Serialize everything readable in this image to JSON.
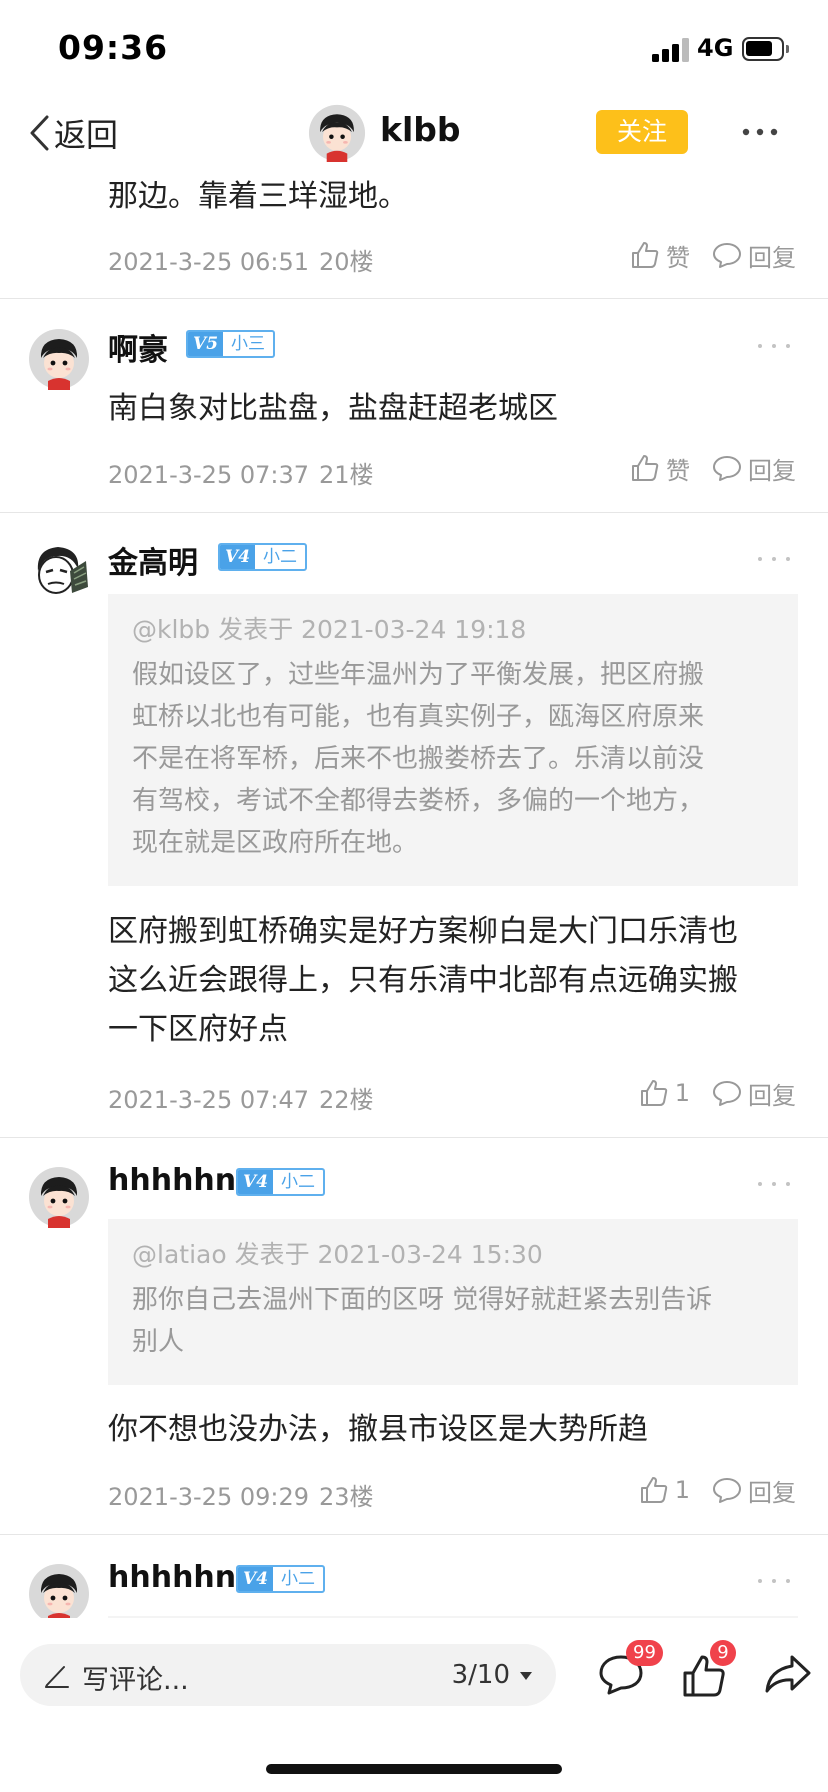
{
  "status_bar": {
    "time": "09:36",
    "network": "4G"
  },
  "nav": {
    "back_label": "返回",
    "username": "klbb",
    "follow_label": "关注"
  },
  "comments": [
    {
      "text": "那边。靠着三垟湿地。",
      "time": "2021-3-25 06:51",
      "floor": "20楼",
      "like_label": "赞",
      "reply_label": "回复"
    },
    {
      "name": "啊豪",
      "level": "V5",
      "rank": "小三",
      "text": "南白象对比盐盘，盐盘赶超老城区",
      "time": "2021-3-25 07:37",
      "floor": "21楼",
      "like_label": "赞",
      "reply_label": "回复"
    },
    {
      "name": "金高明",
      "level": "V4",
      "rank": "小二",
      "quote_meta": "@klbb 发表于 2021-03-24 19:18",
      "quote_lines": [
        "假如设区了，过些年温州为了平衡发展，把区府搬",
        "虹桥以北也有可能，也有真实例子，瓯海区府原来",
        "不是在将军桥，后来不也搬娄桥去了。乐清以前没",
        "有驾校，考试不全都得去娄桥，多偏的一个地方，",
        "现在就是区政府所在地。"
      ],
      "text_lines": [
        "区府搬到虹桥确实是好方案柳白是大门口乐清也",
        "这么近会跟得上，只有乐清中北部有点远确实搬",
        "一下区府好点"
      ],
      "time": "2021-3-25 07:47",
      "floor": "22楼",
      "like_count": "1",
      "reply_label": "回复"
    },
    {
      "name": "hhhhhn",
      "level": "V4",
      "rank": "小二",
      "quote_meta": "@latiao 发表于 2021-03-24 15:30",
      "quote_lines": [
        "那你自己去温州下面的区呀 觉得好就赶紧去别告诉",
        "别人"
      ],
      "text": "你不想也没办法，撤县市设区是大势所趋",
      "time": "2021-3-25 09:29",
      "floor": "23楼",
      "like_count": "1",
      "reply_label": "回复"
    },
    {
      "name": "hhhhhn",
      "level": "V4",
      "rank": "小二"
    }
  ],
  "bottom_bar": {
    "placeholder": "写评论...",
    "page": "3/10",
    "comment_count": "99",
    "like_count": "9"
  },
  "icons": [
    "back-icon",
    "more-icon",
    "like-icon",
    "reply-icon",
    "pen-icon",
    "comment-icon",
    "share-icon"
  ],
  "colors": {
    "follow": "#fdc01a",
    "badge_blue": "#4aa2e8",
    "notification_red": "#f0424b"
  }
}
